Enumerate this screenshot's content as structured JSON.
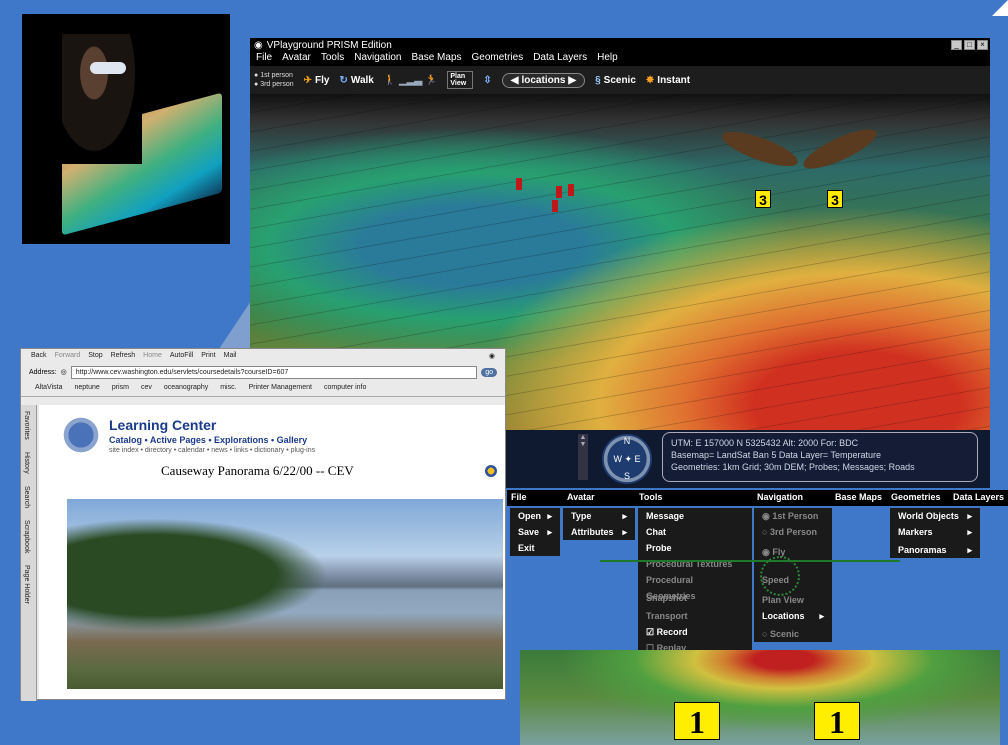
{
  "vp": {
    "title": "VPlayground PRISM Edition",
    "menu": [
      "File",
      "Avatar",
      "Tools",
      "Navigation",
      "Base Maps",
      "Geometries",
      "Data Layers",
      "Help"
    ],
    "person": [
      "1st person",
      "3rd person"
    ],
    "toolbar": {
      "fly": "Fly",
      "walk": "Walk",
      "plan": "Plan View",
      "locations": "locations",
      "scenic": "Scenic",
      "instant": "Instant"
    },
    "badges": [
      "3",
      "3"
    ],
    "coords": {
      "line1": "UTM: E 157000 N 5325432 Alt: 2000 For: BDC",
      "line2": "Basemap= LandSat Ban 5 Data Layer= Temperature",
      "line3": "Geometries: 1km Grid; 30m DEM; Probes; Messages; Roads"
    }
  },
  "browser": {
    "toolbar": [
      "Back",
      "Forward",
      "Stop",
      "Refresh",
      "Home",
      "AutoFill",
      "Print",
      "Mail"
    ],
    "address_label": "Address:",
    "address": "http://www.cev.washington.edu/servlets/coursedetails?courseID=607",
    "go": "go",
    "favorites": [
      "AltaVista",
      "neptune",
      "prism",
      "cev",
      "oceanography",
      "misc.",
      "Printer Management",
      "computer info"
    ],
    "side_tabs": [
      "Favorites",
      "History",
      "Search",
      "Scrapbook",
      "Page Holder"
    ],
    "lc_title": "Learning Center",
    "lc_nav": "Catalog • Active Pages • Explorations • Gallery",
    "lc_sub": "site index • directory • calendar • news • links • dictionary • plug-ins",
    "pano_title": "Causeway Panorama 6/22/00 -- CEV"
  },
  "menus": {
    "bar": [
      "File",
      "Avatar",
      "Tools",
      "Navigation",
      "Base Maps",
      "Geometries",
      "Data Layers"
    ],
    "file": [
      "Open",
      "Save",
      "Exit"
    ],
    "avatar": [
      "Type",
      "Attributes"
    ],
    "tools": [
      "Message",
      "Chat",
      "Probe",
      "Procedural Textures",
      "Procedural Geometries",
      "Snapshot",
      "Transport",
      "Record",
      "Replay"
    ],
    "navigation": [
      "1st Person",
      "3rd Person",
      "Fly",
      "Speed",
      "Plan View",
      "Locations",
      "Scenic"
    ],
    "geometries": [
      "World Objects",
      "Markers",
      "Panoramas"
    ]
  },
  "badges1": [
    "1",
    "1"
  ]
}
